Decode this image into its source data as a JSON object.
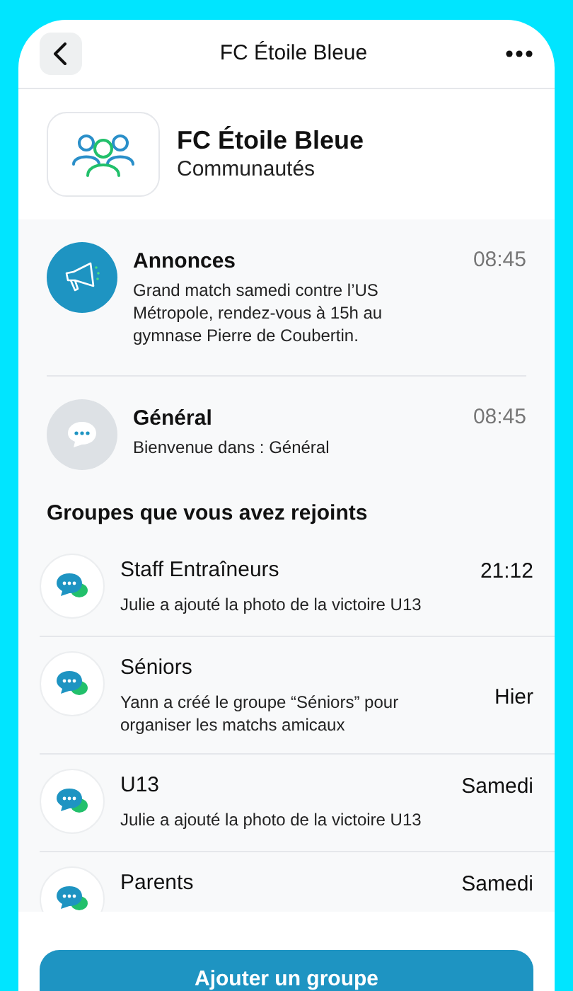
{
  "header": {
    "title": "FC Étoile Bleue"
  },
  "community": {
    "name": "FC Étoile Bleue",
    "subtitle": "Communautés"
  },
  "channels": [
    {
      "kind": "announce",
      "name": "Annonces",
      "preview": "Grand match samedi contre l’US Métropole, rendez-vous à 15h au gymnase Pierre de Coubertin.",
      "time": "08:45"
    },
    {
      "kind": "general",
      "name": "Général",
      "preview": "Bienvenue dans : Général",
      "time": "08:45"
    }
  ],
  "groups_heading": "Groupes que vous avez rejoints",
  "groups": [
    {
      "name": "Staff Entraîneurs",
      "preview": "Julie a ajouté la photo de la victoire U13",
      "time": "21:12"
    },
    {
      "name": "Séniors",
      "preview": "Yann a créé le groupe “Séniors” pour organiser les matchs amicaux",
      "time": "Hier"
    },
    {
      "name": "U13",
      "preview": "Julie a ajouté la photo de la victoire U13",
      "time": "Samedi"
    },
    {
      "name": "Parents",
      "time": "Samedi"
    }
  ],
  "add_button": "Ajouter un groupe"
}
